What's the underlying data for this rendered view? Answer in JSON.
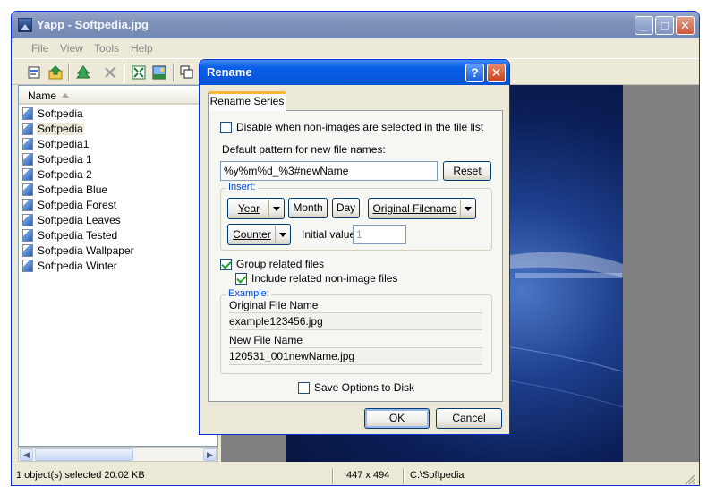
{
  "main_window": {
    "title": "Yapp - Softpedia.jpg",
    "controls": {
      "minimize": "_",
      "maximize": "□",
      "close": "✕"
    }
  },
  "menu": [
    "File",
    "View",
    "Tools",
    "Help"
  ],
  "toolbar": {
    "icons": [
      "properties-icon",
      "up-folder-icon",
      "tree-icon",
      "delete-icon",
      "fit-icon",
      "image-icon",
      "copy-icon"
    ]
  },
  "file_list": {
    "column_header": "Name",
    "selected_index": 1,
    "items": [
      "Softpedia",
      "Softpedia",
      "Softpedia1",
      "Softpedia 1",
      "Softpedia 2",
      "Softpedia Blue",
      "Softpedia Forest",
      "Softpedia Leaves",
      "Softpedia Tested",
      "Softpedia Wallpaper",
      "Softpedia Winter"
    ]
  },
  "status_bar": {
    "selection": "1 object(s) selected 20.02 KB",
    "dimensions": "447 x 494",
    "path": "C:\\Softpedia"
  },
  "dialog": {
    "title": "Rename",
    "help_label": "?",
    "close_label": "✕",
    "tab": "Rename Series",
    "disable_label": "Disable when non-images are selected in the file list",
    "disable_checked": false,
    "pattern_label": "Default pattern for new file names:",
    "pattern_value": "%y%m%d_%3#newName",
    "reset_label": "Reset",
    "insert_legend": "Insert:",
    "year_label": "Year",
    "month_label": "Month",
    "day_label": "Day",
    "original_filename_label": "Original Filename",
    "counter_label": "Counter",
    "initial_value_label": "Initial value",
    "initial_value": "1",
    "group_label": "Group related files",
    "group_checked": true,
    "include_label": "Include related non-image files",
    "include_checked": true,
    "example_legend": "Example:",
    "original_name_label": "Original File Name",
    "original_name_value": "example123456.jpg",
    "new_name_label": "New File Name",
    "new_name_value": "120531_001newName.jpg",
    "save_label": "Save Options to Disk",
    "save_checked": false,
    "ok_label": "OK",
    "cancel_label": "Cancel"
  }
}
